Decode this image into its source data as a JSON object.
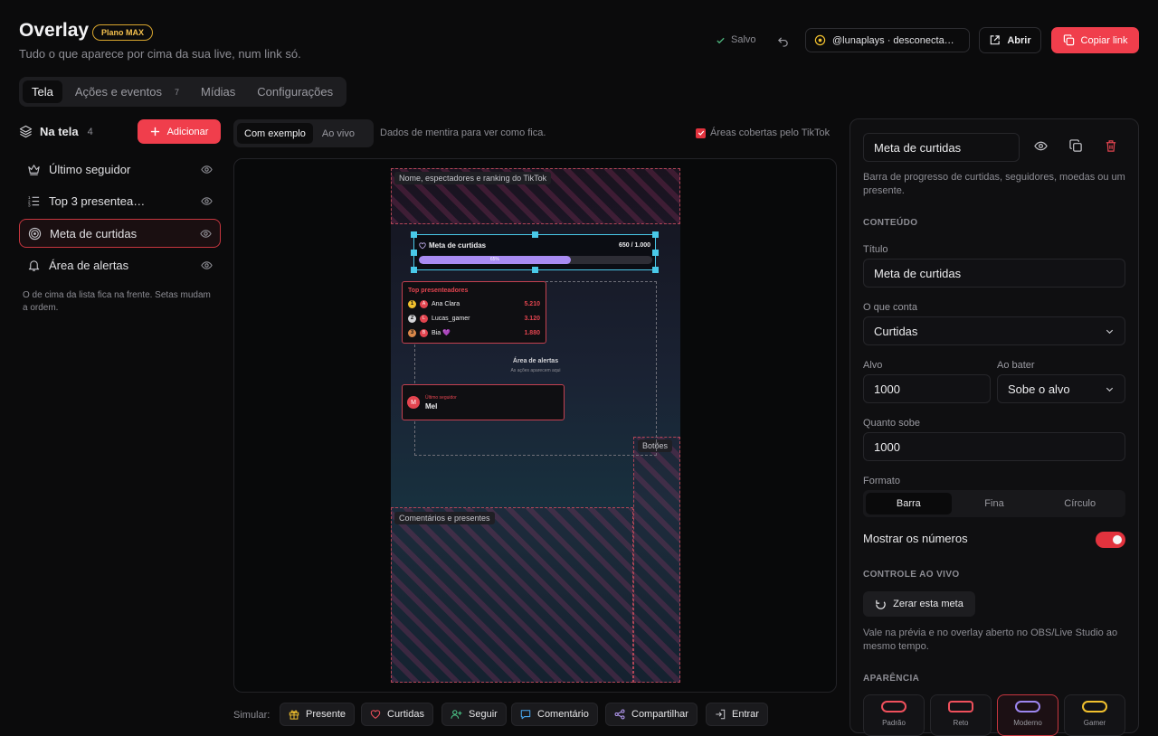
{
  "header": {
    "title": "Overlay",
    "plan_badge": "Plano MAX",
    "subtitle": "Tudo o que aparece por cima da sua live, num link só.",
    "saved_label": "Salvo",
    "account_label": "@lunaplays · desconecta…",
    "open_label": "Abrir",
    "copy_label": "Copiar link"
  },
  "tabs": [
    {
      "label": "Tela",
      "count": ""
    },
    {
      "label": "Ações e eventos",
      "count": "7"
    },
    {
      "label": "Mídias",
      "count": ""
    },
    {
      "label": "Configurações",
      "count": ""
    }
  ],
  "left": {
    "title": "Na tela",
    "count": "4",
    "add_label": "Adicionar",
    "layers": [
      {
        "label": "Último seguidor",
        "icon": "crown-icon"
      },
      {
        "label": "Top 3 presentea…",
        "icon": "list-icon"
      },
      {
        "label": "Meta de curtidas",
        "icon": "target-icon"
      },
      {
        "label": "Área de alertas",
        "icon": "bell-icon"
      }
    ],
    "hint": "O de cima da lista fica na frente. Setas mudam a ordem."
  },
  "preview": {
    "mode_example": "Com exemplo",
    "mode_live": "Ao vivo",
    "mode_note": "Dados de mentira para ver como fica.",
    "covered_label": "Áreas cobertas pelo TikTok",
    "zone_top": "Nome, espectadores e ranking do TikTok",
    "zone_buttons": "Botões",
    "zone_comments": "Comentários e presentes",
    "goal": {
      "title": "Meta de curtidas",
      "value": "650 / 1.000",
      "percent_label": "65%",
      "progress": 0.65
    },
    "ranking": {
      "title": "Top presenteadores",
      "rows": [
        {
          "pos": "1",
          "initial": "A",
          "name": "Ana Clara",
          "points": "5.210"
        },
        {
          "pos": "2",
          "initial": "L",
          "name": "Lucas_gamer",
          "points": "3.120"
        },
        {
          "pos": "3",
          "initial": "B",
          "name": "Bia 💜",
          "points": "1.880"
        }
      ]
    },
    "alerts": {
      "title": "Área de alertas",
      "subtitle": "As ações aparecem aqui"
    },
    "follower": {
      "initial": "M",
      "label": "Último seguidor",
      "name": "Mel"
    }
  },
  "simulate": {
    "label": "Simular:",
    "buttons": [
      "Presente",
      "Curtidas",
      "Seguir",
      "Comentário",
      "Compartilhar",
      "Entrar"
    ]
  },
  "panel": {
    "name": "Meta de curtidas",
    "description": "Barra de progresso de curtidas, seguidores, moedas ou um presente.",
    "section_content": "CONTEÚDO",
    "title_label": "Título",
    "title_value": "Meta de curtidas",
    "counts_label": "O que conta",
    "counts_value": "Curtidas",
    "target_label": "Alvo",
    "target_value": "1000",
    "on_hit_label": "Ao bater",
    "on_hit_value": "Sobe o alvo",
    "step_label": "Quanto sobe",
    "step_value": "1000",
    "format_label": "Formato",
    "formats": [
      "Barra",
      "Fina",
      "Círculo"
    ],
    "show_numbers_label": "Mostrar os números",
    "show_numbers": true,
    "section_live": "CONTROLE AO VIVO",
    "reset_label": "Zerar esta meta",
    "live_note": "Vale na prévia e no overlay aberto no OBS/Live Studio ao mesmo tempo.",
    "section_look": "APARÊNCIA",
    "styles": [
      {
        "label": "Padrão",
        "color": "#f0505c"
      },
      {
        "label": "Reto",
        "color": "#f0505c"
      },
      {
        "label": "Moderno",
        "color": "#9d86f0"
      },
      {
        "label": "Gamer",
        "color": "#f2c12e"
      }
    ]
  },
  "colors": {
    "accent": "#f03e4c",
    "selection": "#49c9e8",
    "progress": "#a98cf3"
  }
}
